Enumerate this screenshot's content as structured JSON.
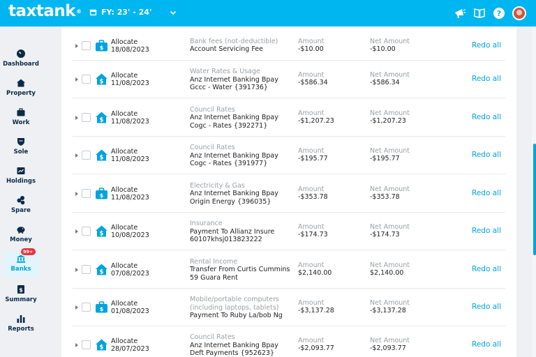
{
  "header": {
    "logo_text": "taxtank",
    "logo_mark": "®",
    "fy_label": "FY: 23' - 24'",
    "icons": [
      "megaphone-icon",
      "book-icon",
      "help-icon",
      "avatar"
    ]
  },
  "colors": {
    "brand": "#00b6f0",
    "accent": "#00a3e0",
    "badge": "#e8333f"
  },
  "sidebar": {
    "items": [
      {
        "label": "Dashboard",
        "icon": "dashboard-icon"
      },
      {
        "label": "Property",
        "icon": "house-icon"
      },
      {
        "label": "Work",
        "icon": "briefcase-icon"
      },
      {
        "label": "Sole",
        "icon": "shield-icon"
      },
      {
        "label": "Holdings",
        "icon": "holdings-icon"
      },
      {
        "label": "Spare",
        "icon": "coins-icon"
      },
      {
        "label": "Money",
        "icon": "piggy-bank-icon"
      },
      {
        "label": "Banks",
        "icon": "bank-icon",
        "badge": "99+",
        "active": true
      },
      {
        "label": "Summary",
        "icon": "summary-icon"
      },
      {
        "label": "Reports",
        "icon": "bar-chart-icon"
      }
    ]
  },
  "transactions": {
    "amount_header": "Amount",
    "net_amount_header": "Net Amount",
    "redo_label": "Redo all",
    "rows": [
      {
        "status": "Allocate",
        "date": "18/08/2023",
        "category": "Bank fees (not-deductible)",
        "desc1": "Account Servicing Fee",
        "desc2": "",
        "amount": "-$10.00",
        "net": "-$10.00",
        "icon": "briefcase"
      },
      {
        "status": "Allocate",
        "date": "11/08/2023",
        "category": "Water Rates & Usage",
        "desc1": "Anz Internet Banking Bpay",
        "desc2": "Gccc - Water {391736}",
        "amount": "-$586.34",
        "net": "-$586.34",
        "icon": "house"
      },
      {
        "status": "Allocate",
        "date": "11/08/2023",
        "category": "Council Rates",
        "desc1": "Anz Internet Banking Bpay",
        "desc2": "Cogc - Rates {392271}",
        "amount": "-$1,207.23",
        "net": "-$1,207.23",
        "icon": "house"
      },
      {
        "status": "Allocate",
        "date": "11/08/2023",
        "category": "Council Rates",
        "desc1": "Anz Internet Banking Bpay",
        "desc2": "Cogc - Rates {391977}",
        "amount": "-$195.77",
        "net": "-$195.77",
        "icon": "house"
      },
      {
        "status": "Allocate",
        "date": "11/08/2023",
        "category": "Electricity & Gas",
        "desc1": "Anz Internet Banking Bpay",
        "desc2": "Origin Energy {396035}",
        "amount": "-$353.78",
        "net": "-$353.78",
        "icon": "briefcase"
      },
      {
        "status": "Allocate",
        "date": "10/08/2023",
        "category": "Insurance",
        "desc1": "Payment To Allianz Insure",
        "desc2": "60107khsj013823222",
        "amount": "-$174.73",
        "net": "-$174.73",
        "icon": "house"
      },
      {
        "status": "Allocate",
        "date": "07/08/2023",
        "category": "Rental Income",
        "desc1": "Transfer From Curtis Cummins",
        "desc2": "59 Guara Rent",
        "amount": "$2,140.00",
        "net": "$2,140.00",
        "icon": "house"
      },
      {
        "status": "Allocate",
        "date": "01/08/2023",
        "category": "Mobile/portable computers",
        "category2": "(including laptops, tablets)",
        "desc1": "Payment To Ruby La/bob Ng",
        "desc2": "",
        "amount": "-$3,137.28",
        "net": "-$3,137.28",
        "icon": "briefcase"
      },
      {
        "status": "Allocate",
        "date": "28/07/2023",
        "category": "Council Rates",
        "desc1": "Anz Internet Banking Bpay",
        "desc2": "Deft Payments {952623}",
        "amount": "-$2,093.77",
        "net": "-$2,093.77",
        "icon": "house"
      }
    ]
  }
}
